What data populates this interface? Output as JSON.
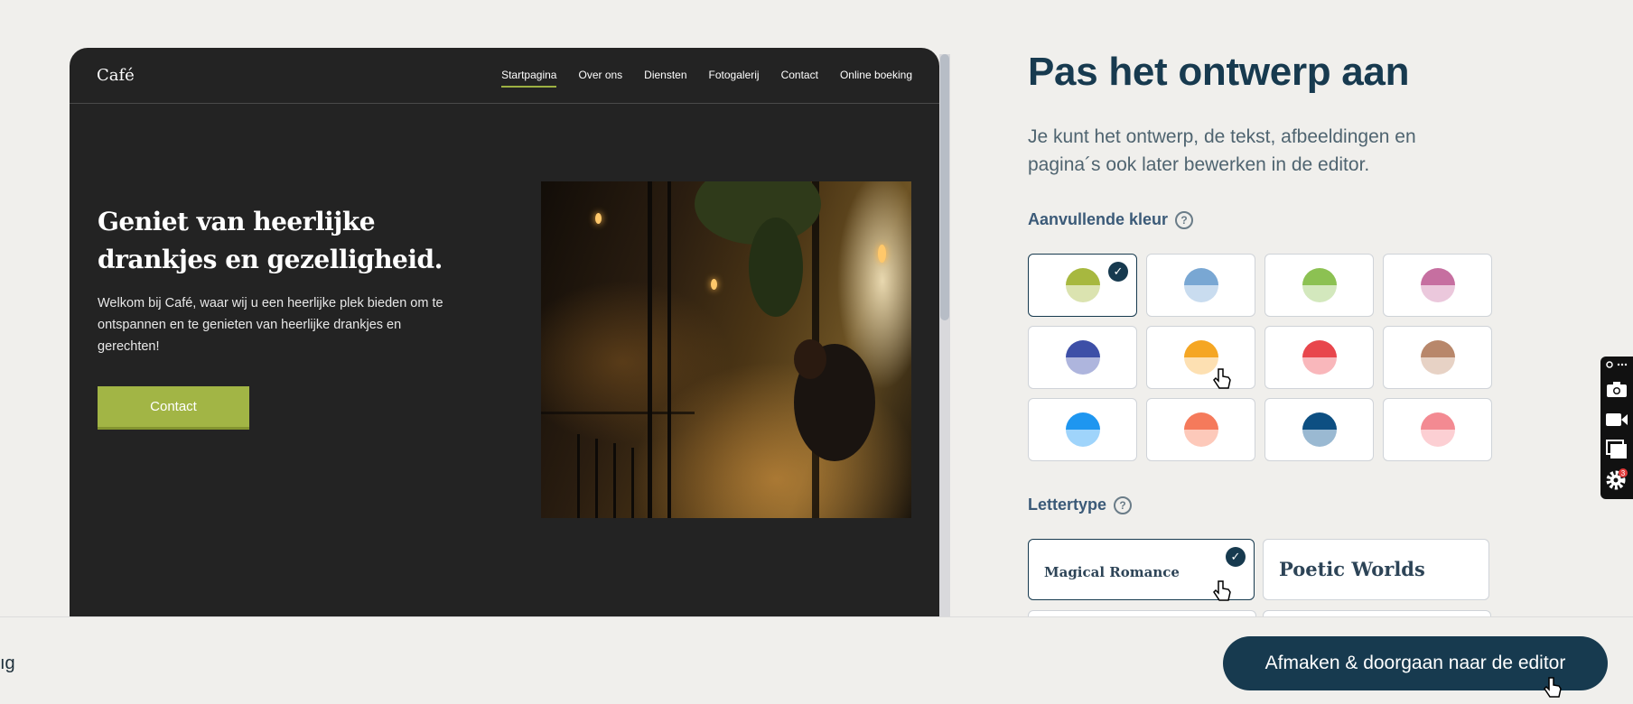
{
  "preview": {
    "logo": "Café",
    "nav": [
      {
        "label": "Startpagina",
        "active": true
      },
      {
        "label": "Over ons",
        "active": false
      },
      {
        "label": "Diensten",
        "active": false
      },
      {
        "label": "Fotogalerij",
        "active": false
      },
      {
        "label": "Contact",
        "active": false
      },
      {
        "label": "Online boeking",
        "active": false
      }
    ],
    "hero_title": "Geniet van heerlijke drankjes en gezelligheid.",
    "hero_text": "Welkom bij Café, waar wij u een heerlijke plek bieden om te ontspannen en te genieten van heerlijke drankjes en gerechten!",
    "hero_button": "Contact",
    "hero_image_icon": "cafe-photo"
  },
  "panel": {
    "title": "Pas het ontwerp aan",
    "subtitle": "Je kunt het ontwerp, de tekst, afbeeldingen en pagina´s ook later bewerken in de editor.",
    "color_label": "Aanvullende kleur",
    "font_label": "Lettertype",
    "help_glyph": "?",
    "check_glyph": "✓",
    "colors": [
      {
        "top": "#a7b83f",
        "bottom": "#dbe3b0",
        "selected": true
      },
      {
        "top": "#79a7d3",
        "bottom": "#c9dcef",
        "selected": false
      },
      {
        "top": "#8cc152",
        "bottom": "#d3e8bd",
        "selected": false
      },
      {
        "top": "#c66fa0",
        "bottom": "#ebc8dc",
        "selected": false
      },
      {
        "top": "#3d4fa7",
        "bottom": "#aeb5dd",
        "selected": false
      },
      {
        "top": "#f5a623",
        "bottom": "#fde0b2",
        "selected": false
      },
      {
        "top": "#e8464c",
        "bottom": "#f9b7bb",
        "selected": false
      },
      {
        "top": "#b8876b",
        "bottom": "#e7d2c5",
        "selected": false
      },
      {
        "top": "#1e96f0",
        "bottom": "#9fd4fb",
        "selected": false
      },
      {
        "top": "#f57a5b",
        "bottom": "#fdc9ba",
        "selected": false
      },
      {
        "top": "#0d4f82",
        "bottom": "#9ab9d2",
        "selected": false
      },
      {
        "top": "#f38a92",
        "bottom": "#fccfd3",
        "selected": false
      }
    ],
    "fonts": [
      {
        "name": "Magical Romance",
        "selected": true
      },
      {
        "name": "Poetic Worlds",
        "selected": false
      }
    ]
  },
  "bottom": {
    "back_label": "ıg",
    "finish_button": "Afmaken & doorgaan naar de editor"
  },
  "toolbar": {
    "icons": [
      "link-more-icon",
      "camera-icon",
      "video-icon",
      "window-icon",
      "settings-icon"
    ],
    "settings_badge": "3"
  }
}
